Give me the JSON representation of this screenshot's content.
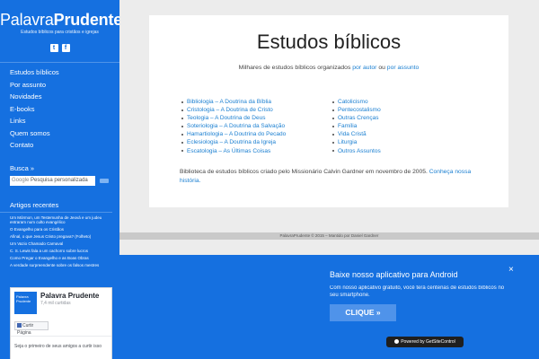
{
  "site": {
    "logo_light": "Palavra",
    "logo_bold": "Prudente",
    "tagline": "Estudos bíblicos para cristãos e igrejas",
    "social": [
      {
        "icon": "twitter-icon",
        "glyph": "t"
      },
      {
        "icon": "facebook-icon",
        "glyph": "f"
      }
    ]
  },
  "nav": {
    "items": [
      {
        "label": "Estudos bíblicos"
      },
      {
        "label": "Por assunto"
      },
      {
        "label": "Novidades"
      },
      {
        "label": "E-books"
      },
      {
        "label": "Links"
      },
      {
        "label": "Quem somos"
      },
      {
        "label": "Contato"
      }
    ]
  },
  "search": {
    "title": "Busca »",
    "google": "Google",
    "placeholder": "Pesquisa personalizada"
  },
  "articles": {
    "title": "Artigos recentes",
    "items": [
      "Um Mórmon, um Testemunha de Jeová e um judeu entraram num culto evangélico",
      "O Evangelho para os Cristãos",
      "Afinal, o que Jesus Cristo pregava? (Folheto)",
      "Um Vazio Chamado Carnaval",
      "C. S. Lewis fala a um cachorro sobre lucros",
      "Como Pregar o Evangelho e as Boas Obras",
      "A verdade surpreendente sobre os falsos mestres"
    ]
  },
  "facebook": {
    "thumb_text": "Palavra Prudente",
    "page_name": "Palavra Prudente",
    "likes": "7,4 mil curtidas",
    "like_button": "Curtir Página",
    "friends_text": "Seja o primeiro de seus amigos a curtir isso"
  },
  "main": {
    "title": "Estudos bíblicos",
    "intro_prefix": "Milhares de estudos bíblicos organizados ",
    "intro_link1": "por autor",
    "intro_mid": " ou ",
    "intro_link2": "por assunto",
    "col1": [
      "Bibliologia – A Doutrina da Bíblia",
      "Cristologia – A Doutrina de Cristo",
      "Teologia – A Doutrina de Deus",
      "Soteriologia – A Doutrina da Salvação",
      "Hamartiologia – A Doutrina do Pecado",
      "Eclesiologia – A Doutrina da Igreja",
      "Escatologia – As Últimas Coisas"
    ],
    "col2": [
      "Catolicismo",
      "Pentecostalismo",
      "Outras Crenças",
      "Família",
      "Vida Cristã",
      "Liturgia",
      "Outros Assuntos"
    ],
    "footer_text": "Biblioteca de estudos bíblicos criado pelo Missionário Calvin Gardner em novembro de 2005. ",
    "footer_link": "Conheça nossa história."
  },
  "footer": {
    "text": "PalavraPrudente © 2015 – Mantido por Daniel Gardner"
  },
  "popup": {
    "title": "Baixe nosso aplicativo para Android",
    "description": "Com nosso aplicativo gratuito, você terá centenas de estudos bíblicos no seu smartphone.",
    "cta": "CLIQUE »",
    "close": "×",
    "powered": "Powered by GetSiteControl"
  },
  "colors": {
    "brand_blue": "#1570e0",
    "link_blue": "#1a7fd1"
  }
}
